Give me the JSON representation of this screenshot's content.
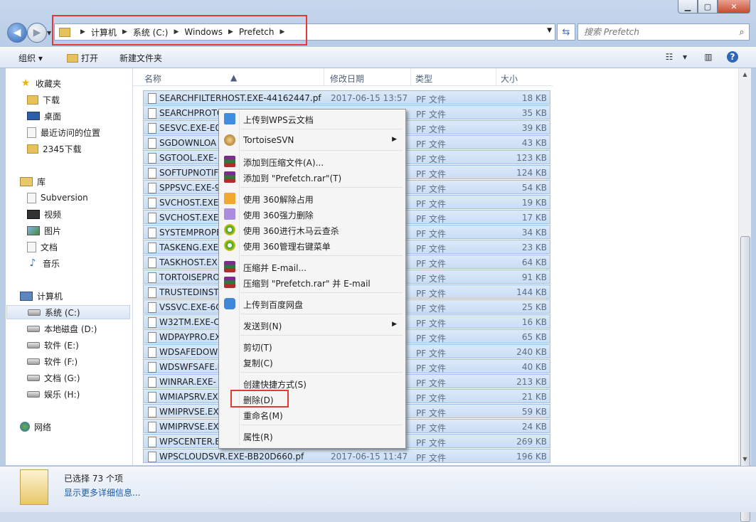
{
  "window": {
    "min_icon": "minimize-icon",
    "max_icon": "maximize-icon",
    "close_label": "✕"
  },
  "address": {
    "crumbs": [
      "计算机",
      "系统 (C:)",
      "Windows",
      "Prefetch"
    ]
  },
  "search": {
    "placeholder": "搜索 Prefetch"
  },
  "toolbar": {
    "organize": "组织 ▾",
    "open": "打开",
    "new_folder": "新建文件夹"
  },
  "nav": {
    "favorites": "收藏夹",
    "downloads": "下载",
    "desktop": "桌面",
    "recent": "最近访问的位置",
    "dl2345": "2345下载",
    "libraries": "库",
    "subversion": "Subversion",
    "videos": "视频",
    "pictures": "图片",
    "documents": "文档",
    "music": "音乐",
    "computer": "计算机",
    "drive_c": "系统 (C:)",
    "drive_d": "本地磁盘 (D:)",
    "drive_e": "软件 (E:)",
    "drive_f": "软件 (F:)",
    "drive_g": "文档 (G:)",
    "drive_h": "娱乐 (H:)",
    "network": "网络"
  },
  "columns": {
    "name": "名称",
    "date": "修改日期",
    "type": "类型",
    "size": "大小"
  },
  "files": [
    {
      "name": "SEARCHFILTERHOST.EXE-44162447.pf",
      "date": "2017-06-15 13:57",
      "type": "PF 文件",
      "size": "18 KB"
    },
    {
      "name": "SEARCHPROTO",
      "date": "",
      "type": "PF 文件",
      "size": "35 KB"
    },
    {
      "name": "SESVC.EXE-E0",
      "date": "",
      "type": "PF 文件",
      "size": "39 KB"
    },
    {
      "name": "SGDOWNLOA",
      "date": "",
      "type": "PF 文件",
      "size": "43 KB"
    },
    {
      "name": "SGTOOL.EXE-",
      "date": "",
      "type": "PF 文件",
      "size": "123 KB"
    },
    {
      "name": "SOFTUPNOTIF",
      "date": "",
      "type": "PF 文件",
      "size": "124 KB"
    },
    {
      "name": "SPPSVC.EXE-9",
      "date": "",
      "type": "PF 文件",
      "size": "54 KB"
    },
    {
      "name": "SVCHOST.EXE",
      "date": "",
      "type": "PF 文件",
      "size": "19 KB"
    },
    {
      "name": "SVCHOST.EXE",
      "date": "",
      "type": "PF 文件",
      "size": "17 KB"
    },
    {
      "name": "SYSTEMPROPE",
      "date": "",
      "type": "PF 文件",
      "size": "34 KB"
    },
    {
      "name": "TASKENG.EXE",
      "date": "",
      "type": "PF 文件",
      "size": "23 KB"
    },
    {
      "name": "TASKHOST.EX",
      "date": "",
      "type": "PF 文件",
      "size": "64 KB"
    },
    {
      "name": "TORTOISEPRO",
      "date": "",
      "type": "PF 文件",
      "size": "91 KB"
    },
    {
      "name": "TRUSTEDINST",
      "date": "",
      "type": "PF 文件",
      "size": "144 KB"
    },
    {
      "name": "VSSVC.EXE-6C",
      "date": "",
      "type": "PF 文件",
      "size": "25 KB"
    },
    {
      "name": "W32TM.EXE-C",
      "date": "",
      "type": "PF 文件",
      "size": "16 KB"
    },
    {
      "name": "WDPAYPRO.EX",
      "date": "",
      "type": "PF 文件",
      "size": "65 KB"
    },
    {
      "name": "WDSAFEDOWI",
      "date": "",
      "type": "PF 文件",
      "size": "240 KB"
    },
    {
      "name": "WDSWFSAFE.E",
      "date": "",
      "type": "PF 文件",
      "size": "40 KB"
    },
    {
      "name": "WINRAR.EXE-",
      "date": "",
      "type": "PF 文件",
      "size": "213 KB"
    },
    {
      "name": "WMIAPSRV.EX",
      "date": "",
      "type": "PF 文件",
      "size": "21 KB"
    },
    {
      "name": "WMIPRVSE.EX",
      "date": "",
      "type": "PF 文件",
      "size": "59 KB"
    },
    {
      "name": "WMIPRVSE.EX",
      "date": "",
      "type": "PF 文件",
      "size": "24 KB"
    },
    {
      "name": "WPSCENTER.E",
      "date": "",
      "type": "PF 文件",
      "size": "269 KB"
    },
    {
      "name": "WPSCLOUDSVR.EXE-BB20D660.pf",
      "date": "2017-06-15 11:47",
      "type": "PF 文件",
      "size": "196 KB"
    }
  ],
  "menu": {
    "wps": "上传到WPS云文档",
    "svn": "TortoiseSVN",
    "add_archive": "添加到压缩文件(A)...",
    "add_rar": "添加到 \"Prefetch.rar\"(T)",
    "unlock360": "使用 360解除占用",
    "forcedel360": "使用 360强力删除",
    "scan360": "使用 360进行木马云查杀",
    "manage360": "使用 360管理右键菜单",
    "zip_email": "压缩并 E-mail...",
    "rar_email": "压缩到 \"Prefetch.rar\" 并 E-mail",
    "baidu": "上传到百度网盘",
    "sendto": "发送到(N)",
    "cut": "剪切(T)",
    "copy": "复制(C)",
    "shortcut": "创建快捷方式(S)",
    "delete": "删除(D)",
    "rename": "重命名(M)",
    "properties": "属性(R)"
  },
  "status": {
    "selected": "已选择 73 个项",
    "more": "显示更多详细信息..."
  },
  "colors": {
    "highlight": "#e53935",
    "selection": "#cfe1f6"
  }
}
